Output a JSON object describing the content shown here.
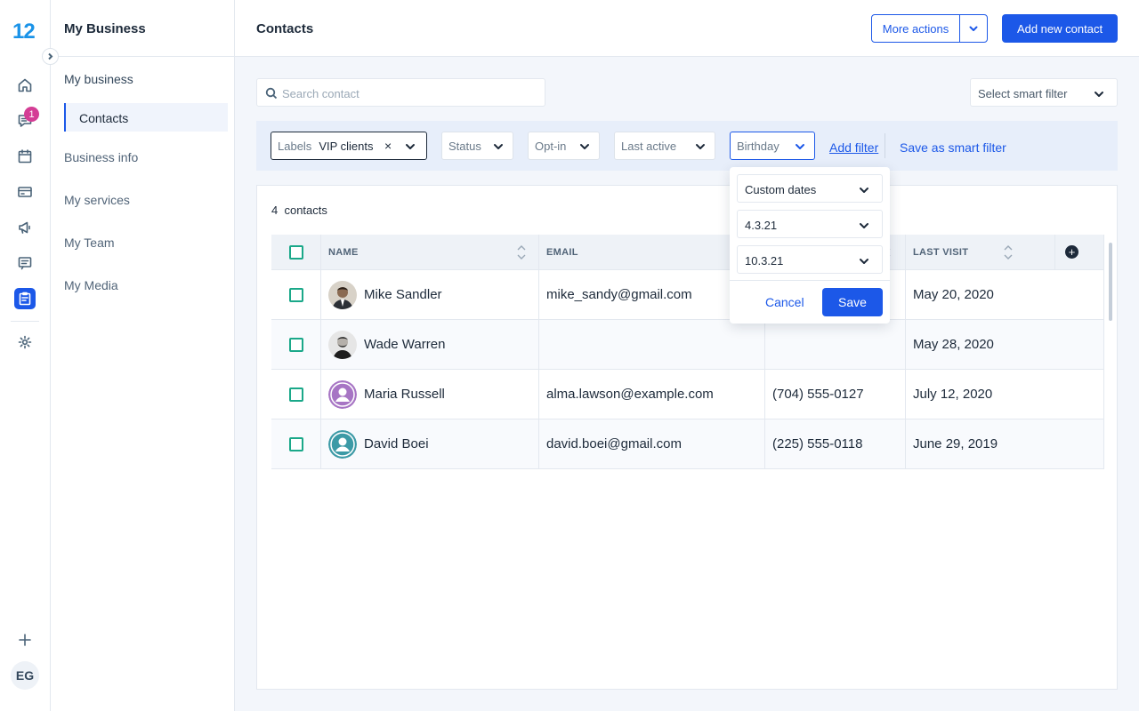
{
  "app": {
    "logo": "12",
    "user_initials": "EG",
    "notifications_count": "1"
  },
  "sidebar": {
    "title": "My Business",
    "items": [
      {
        "label": "My business"
      },
      {
        "label": "Contacts"
      },
      {
        "label": "Business info"
      },
      {
        "label": "My services"
      },
      {
        "label": "My Team"
      },
      {
        "label": "My Media"
      }
    ]
  },
  "header": {
    "title": "Contacts",
    "more_actions": "More actions",
    "add_contact": "Add new contact"
  },
  "search": {
    "placeholder": "Search contact"
  },
  "smart_filter": {
    "placeholder": "Select smart filter"
  },
  "filters": {
    "labels": {
      "label": "Labels",
      "value": "VIP clients",
      "clear": "×"
    },
    "status": "Status",
    "optin": "Opt-in",
    "last_active": "Last active",
    "birthday": "Birthday",
    "add_filter": "Add filter",
    "save_smart": "Save as smart filter"
  },
  "birthday_popup": {
    "range": "Custom dates",
    "from": "4.3.21",
    "to": "10.3.21",
    "cancel": "Cancel",
    "save": "Save"
  },
  "table": {
    "count": "4",
    "count_label": "contacts",
    "columns": [
      "NAME",
      "EMAIL",
      "LAST VISIT"
    ],
    "add_column": "+",
    "rows": [
      {
        "name": "Mike Sandler",
        "email": "mike_sandy@gmail.com",
        "phone": "",
        "last_visit": "May 20, 2020",
        "avatar": "photo-man-1"
      },
      {
        "name": "Wade Warren",
        "email": "",
        "phone": "",
        "last_visit": "May 28, 2020",
        "avatar": "photo-man-2"
      },
      {
        "name": "Maria Russell",
        "email": "alma.lawson@example.com",
        "phone": "(704) 555-0127",
        "last_visit": "July 12, 2020",
        "avatar": "placeholder-purple"
      },
      {
        "name": "David Boei",
        "email": "david.boei@gmail.com",
        "phone": "(225) 555-0118",
        "last_visit": "June 29, 2019",
        "avatar": "placeholder-teal"
      }
    ]
  },
  "colors": {
    "accent": "#1c58e8",
    "checkbox": "#1aa889",
    "badge": "#d43d95",
    "logo": "#1a93e8"
  }
}
